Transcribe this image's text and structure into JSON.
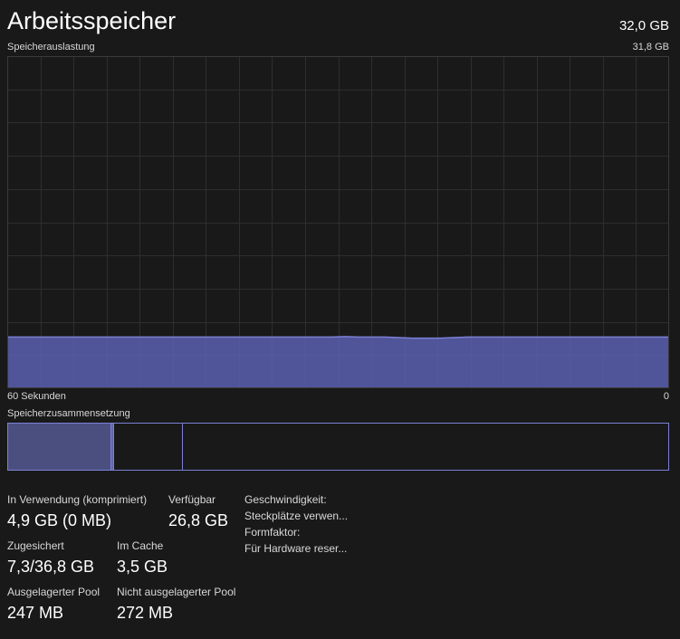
{
  "header": {
    "title": "Arbeitsspeicher",
    "total": "32,0 GB"
  },
  "usage_graph": {
    "label": "Speicherauslastung",
    "max_label": "31,8 GB",
    "time_left": "60 Sekunden",
    "time_right": "0",
    "ylim_gb": [
      0,
      31.8
    ],
    "samples_gb": [
      4.9,
      4.9,
      4.9,
      4.9,
      4.9,
      4.9,
      4.9,
      4.9,
      4.9,
      4.9,
      4.9,
      4.9,
      4.9,
      4.9,
      4.9,
      4.9,
      4.9,
      4.9,
      4.9,
      4.9,
      4.9,
      4.9,
      4.9,
      4.9,
      4.9,
      4.95,
      4.9,
      4.9,
      4.9,
      4.85,
      4.8,
      4.8,
      4.8,
      4.85,
      4.9,
      4.9,
      4.9,
      4.9,
      4.9,
      4.9,
      4.9,
      4.9,
      4.9,
      4.9,
      4.9,
      4.9,
      4.9,
      4.9,
      4.9,
      4.9
    ],
    "line_color": "#7b80d6",
    "fill_color": "#5a60b0",
    "grid_color": "#2e2e2e"
  },
  "composition": {
    "label": "Speicherzusammensetzung",
    "used_color": "#4a4f80",
    "border_color": "#7b80d6"
  },
  "stats": {
    "in_use_label": "In Verwendung (komprimiert)",
    "in_use_value": "4,9 GB (0 MB)",
    "available_label": "Verfügbar",
    "available_value": "26,8 GB",
    "committed_label": "Zugesichert",
    "committed_value": "7,3/36,8 GB",
    "cached_label": "Im Cache",
    "cached_value": "3,5 GB",
    "paged_label": "Ausgelagerter Pool",
    "paged_value": "247 MB",
    "nonpaged_label": "Nicht ausgelagerter Pool",
    "nonpaged_value": "272 MB"
  },
  "info": {
    "speed": "Geschwindigkeit:",
    "slots": "Steckplätze verwen...",
    "form": "Formfaktor:",
    "reserved": "Für Hardware reser..."
  }
}
